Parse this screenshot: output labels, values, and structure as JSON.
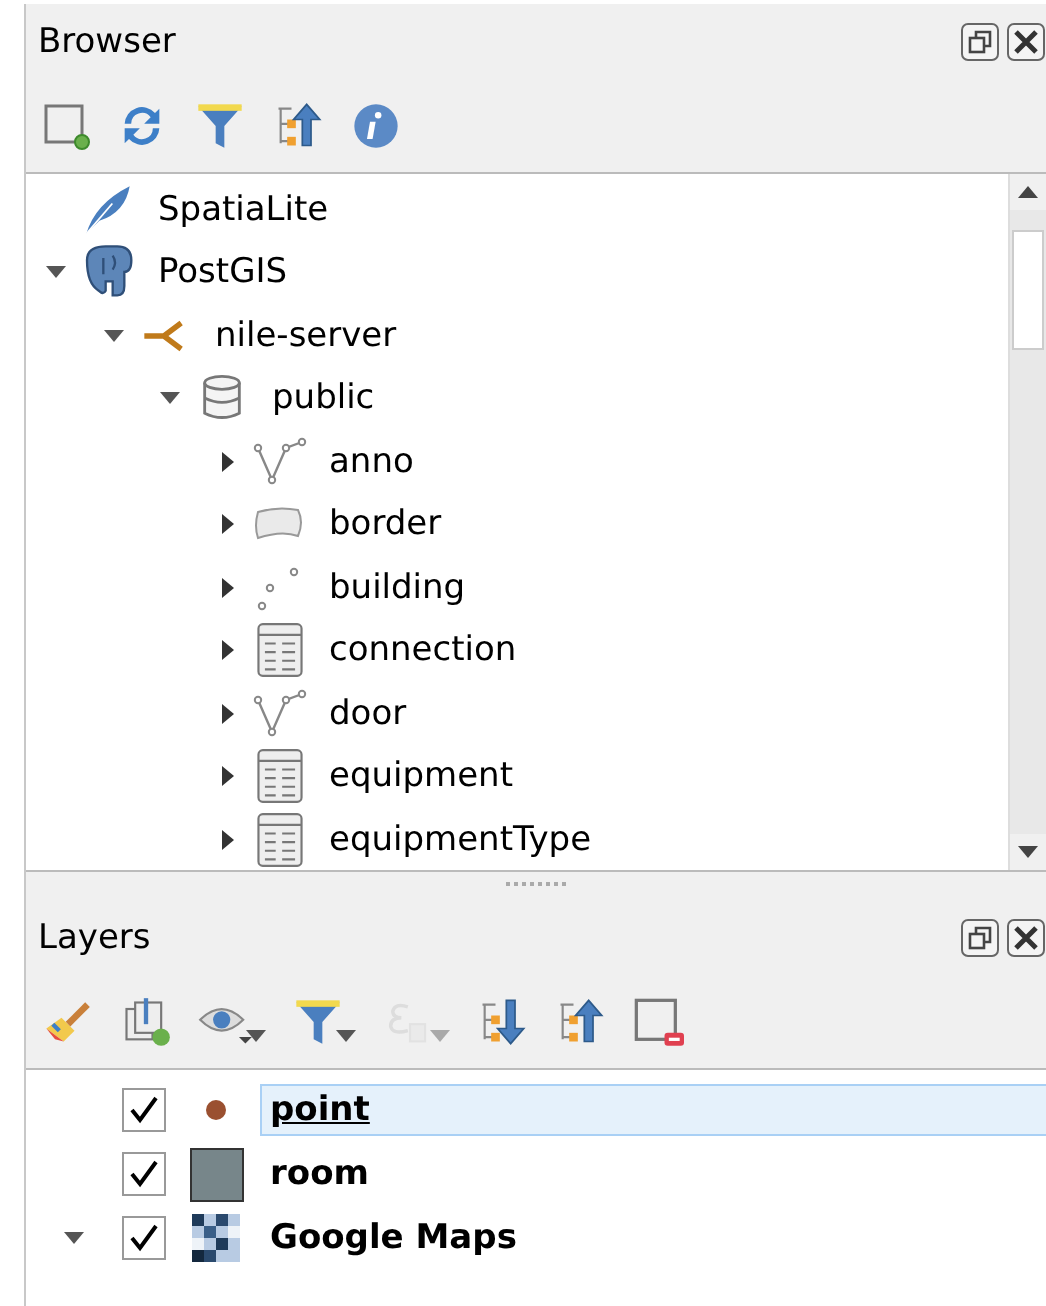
{
  "browser": {
    "title": "Browser",
    "toolbar": [
      {
        "kind": "add"
      },
      {
        "kind": "refresh"
      },
      {
        "kind": "filter"
      },
      {
        "kind": "collapse"
      },
      {
        "kind": "info"
      }
    ],
    "tree": [
      {
        "label": "SpatiaLite",
        "kind": "spatialite"
      },
      {
        "label": "PostGIS",
        "kind": "postgis",
        "expanded": true,
        "children": [
          {
            "label": "nile-server",
            "kind": "connection",
            "expanded": true,
            "children": [
              {
                "label": "public",
                "kind": "schema",
                "expanded": true,
                "children": [
                  {
                    "label": "anno",
                    "kind": "line",
                    "expanded": false
                  },
                  {
                    "label": "border",
                    "kind": "polygon",
                    "expanded": false
                  },
                  {
                    "label": "building",
                    "kind": "points",
                    "expanded": false
                  },
                  {
                    "label": "connection",
                    "kind": "table",
                    "expanded": false
                  },
                  {
                    "label": "door",
                    "kind": "line",
                    "expanded": false
                  },
                  {
                    "label": "equipment",
                    "kind": "table",
                    "expanded": false
                  },
                  {
                    "label": "equipmentType",
                    "kind": "table",
                    "expanded": false
                  }
                ]
              }
            ]
          }
        ]
      }
    ]
  },
  "layers": {
    "title": "Layers",
    "toolbar": [
      {
        "kind": "style",
        "disabled": false,
        "menu": false
      },
      {
        "kind": "group",
        "disabled": false,
        "menu": false
      },
      {
        "kind": "eye",
        "disabled": false,
        "menu": true
      },
      {
        "kind": "filter",
        "disabled": false,
        "menu": true
      },
      {
        "kind": "expression",
        "disabled": true,
        "menu": true
      },
      {
        "kind": "expand",
        "disabled": false,
        "menu": false
      },
      {
        "kind": "collapse",
        "disabled": false,
        "menu": false
      },
      {
        "kind": "remove",
        "disabled": false,
        "menu": false
      }
    ],
    "items": [
      {
        "label": "point",
        "kind": "point",
        "color": "#9a5030",
        "checked": true,
        "selected": true
      },
      {
        "label": "room",
        "kind": "fill",
        "color": "#77868a",
        "checked": true,
        "selected": false
      },
      {
        "label": "Google Maps",
        "kind": "raster",
        "checked": true,
        "selected": false,
        "expanded": true
      }
    ]
  }
}
